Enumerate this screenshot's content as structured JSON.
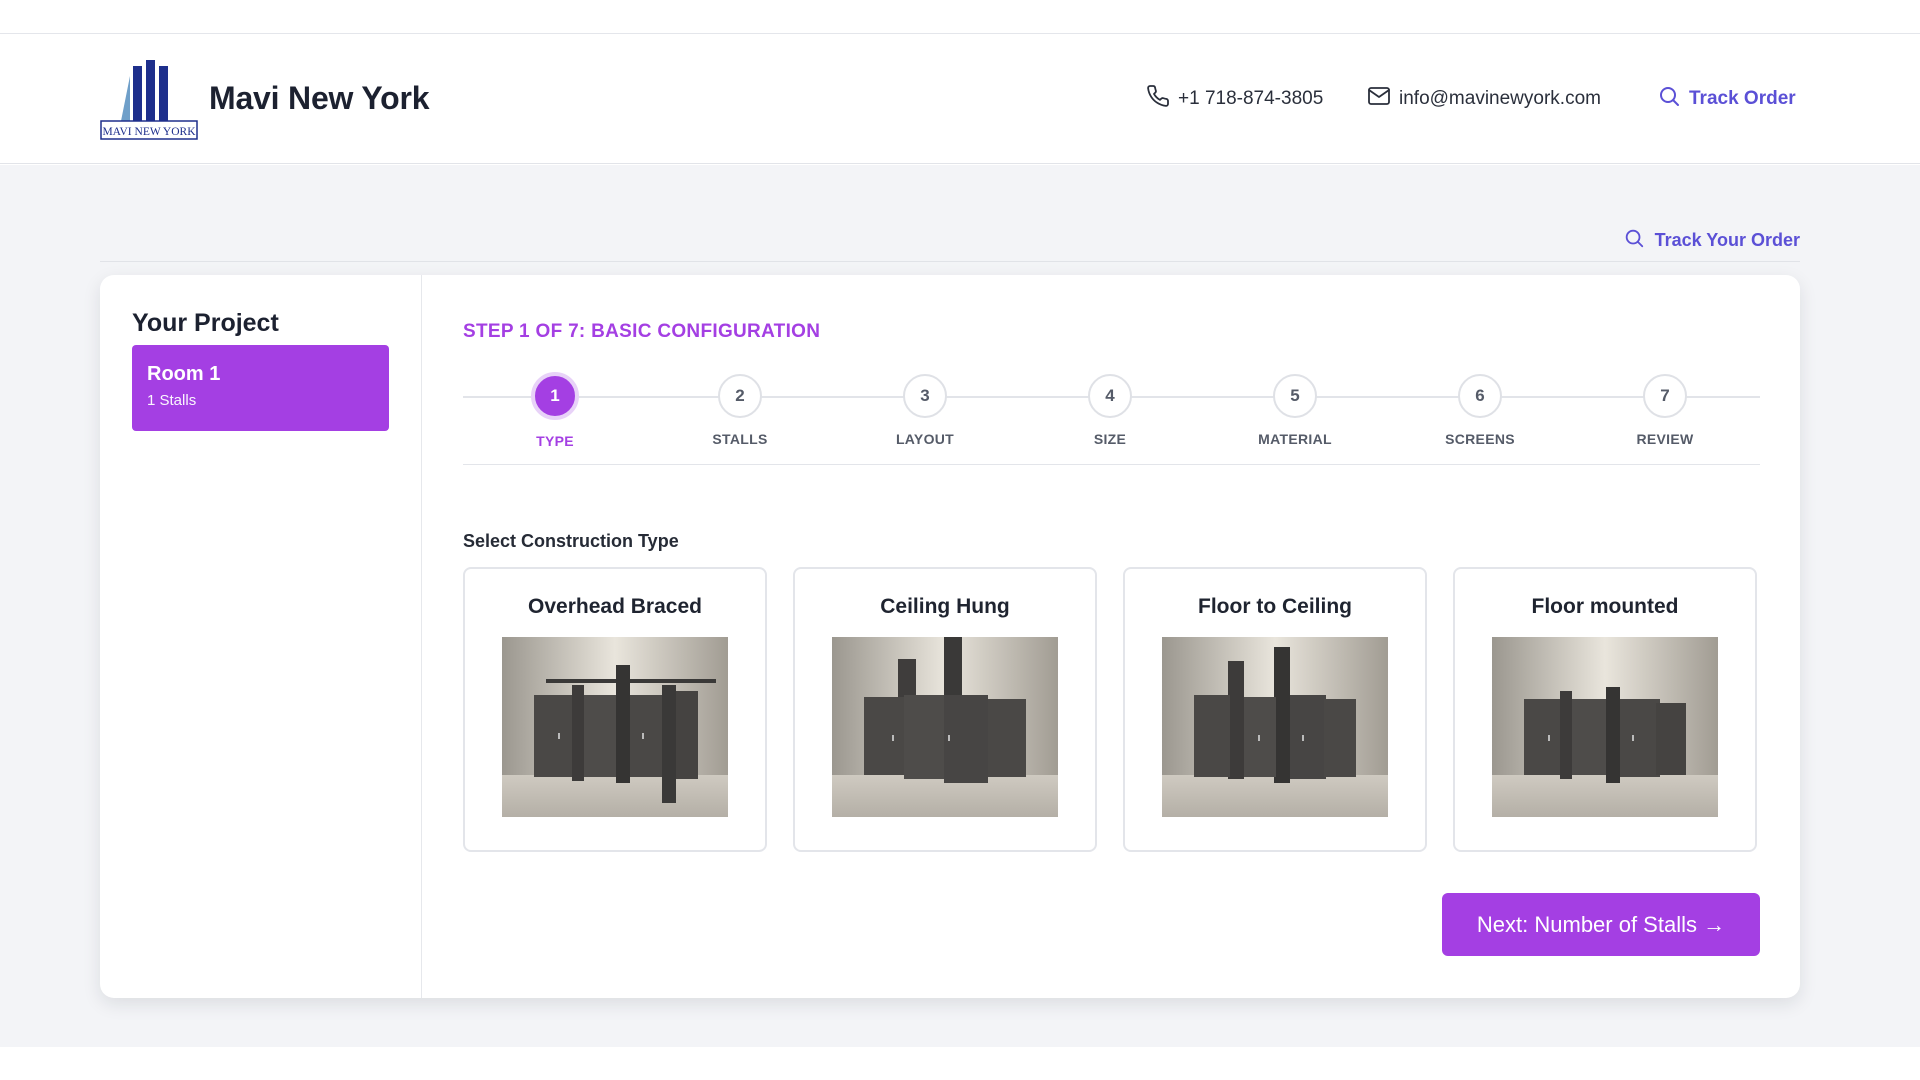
{
  "header": {
    "brand": "Mavi New York",
    "logo_text": "MAVI NEW YORK",
    "phone": "+1 718-874-3805",
    "email": "info@mavinewyork.com",
    "track_order": "Track Order",
    "icons": {
      "phone": "phone-icon",
      "email": "mail-icon",
      "search": "search-icon"
    }
  },
  "subheader": {
    "track_your_order": "Track Your Order"
  },
  "sidebar": {
    "title": "Your Project",
    "rooms": [
      {
        "name": "Room 1",
        "subtitle": "1 Stalls"
      }
    ]
  },
  "wizard": {
    "heading": "STEP 1 OF 7: BASIC CONFIGURATION",
    "steps": [
      {
        "number": "1",
        "label": "TYPE"
      },
      {
        "number": "2",
        "label": "STALLS"
      },
      {
        "number": "3",
        "label": "LAYOUT"
      },
      {
        "number": "4",
        "label": "SIZE"
      },
      {
        "number": "5",
        "label": "MATERIAL"
      },
      {
        "number": "6",
        "label": "SCREENS"
      },
      {
        "number": "7",
        "label": "REVIEW"
      }
    ],
    "active_step": 1,
    "section_label": "Select Construction Type",
    "options": [
      {
        "title": "Overhead Braced"
      },
      {
        "title": "Ceiling Hung"
      },
      {
        "title": "Floor to Ceiling"
      },
      {
        "title": "Floor mounted"
      }
    ],
    "next_button": "Next: Number of Stalls →"
  },
  "colors": {
    "accent": "#a43fe3",
    "link": "#5b50d6",
    "background": "#f3f4f7"
  }
}
